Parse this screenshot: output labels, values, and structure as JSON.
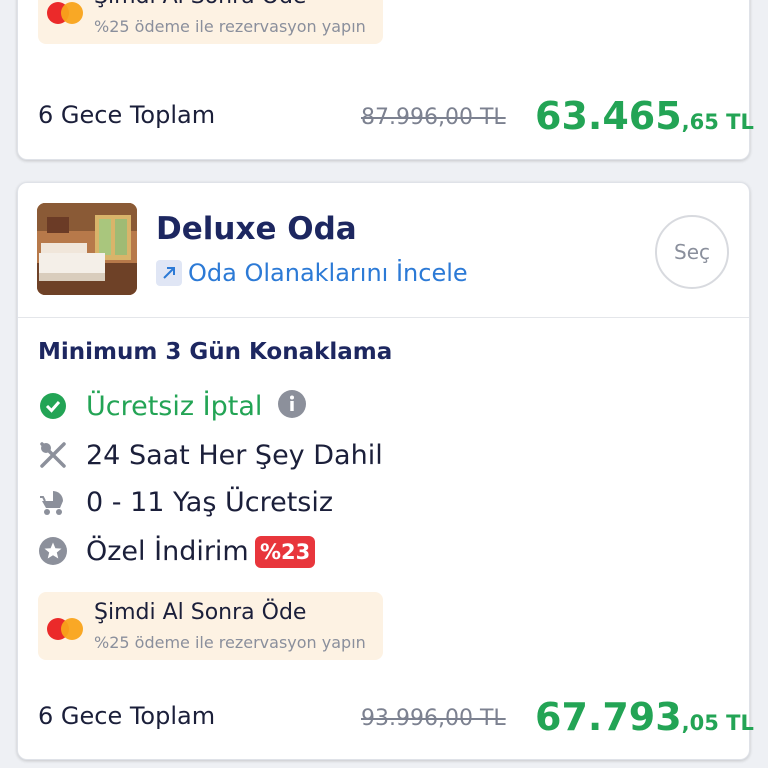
{
  "offer_top": {
    "promo_title": "Şimdi Al Sonra Öde",
    "promo_subtitle": "%25 ödeme ile rezervasyon yapın",
    "total_label": "6 Gece Toplam",
    "old_price": "87.996,00 TL",
    "new_price_main": "63.465",
    "new_price_decimals": ",65 TL"
  },
  "room": {
    "title": "Deluxe Oda",
    "details_link": "Oda Olanaklarını İncele",
    "select_label": "Seç",
    "min_stay": "Minimum 3 Gün Konaklama",
    "features": [
      {
        "icon": "check-circle-icon",
        "label": "Ücretsiz İptal"
      },
      {
        "icon": "fork-knife-icon",
        "label": "24 Saat Her Şey Dahil"
      },
      {
        "icon": "stroller-icon",
        "label": "0 - 11 Yaş Ücretsiz"
      },
      {
        "icon": "star-badge-icon",
        "label": "Özel İndirim"
      }
    ],
    "discount_badge": "%23",
    "promo_title": "Şimdi Al Sonra Öde",
    "promo_subtitle": "%25 ödeme ile rezervasyon yapın",
    "total_label": "6 Gece Toplam",
    "old_price": "93.996,00 TL",
    "new_price_main": "67.793",
    "new_price_decimals": ",05 TL"
  },
  "colors": {
    "price_green": "#23a455",
    "title_navy": "#1d2760",
    "link_blue": "#2c7ad6",
    "badge_red": "#e8363c",
    "promo_bg": "#fdf2e3"
  }
}
